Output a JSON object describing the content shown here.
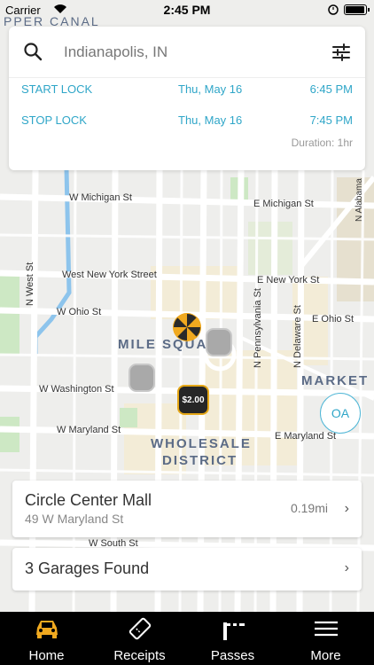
{
  "status_bar": {
    "carrier": "Carrier",
    "time": "2:45 PM"
  },
  "search": {
    "location": "Indianapolis, IN"
  },
  "lock": {
    "start": {
      "label": "START LOCK",
      "date": "Thu, May 16",
      "time": "6:45 PM"
    },
    "stop": {
      "label": "STOP LOCK",
      "date": "Thu, May 16",
      "time": "7:45 PM"
    },
    "duration": "Duration: 1hr"
  },
  "map": {
    "streets": {
      "w_michigan": "W Michigan St",
      "e_michigan": "E Michigan St",
      "west_new_york": "West New York Street",
      "e_new_york": "E New York St",
      "w_ohio": "W Ohio St",
      "e_ohio": "E Ohio St",
      "w_washington": "W Washington St",
      "w_maryland": "W Maryland St",
      "e_maryland": "E Maryland St",
      "w_south": "W South St",
      "n_west": "N West St",
      "n_pennsylvania": "N Pennsylvania St",
      "n_delaware": "N Delaware St",
      "n_alabama": "N Alabama",
      "canal": "PPER CANAL"
    },
    "districts": {
      "mile_square": "MILE SQUARE",
      "wholesale": "WHOLESALE",
      "district": "DISTRICT",
      "market": "MARKET"
    },
    "price_marker": "$2.00",
    "oa_button": "OA"
  },
  "result": {
    "name": "Circle Center Mall",
    "address": "49 W Maryland St",
    "distance": "0.19mi"
  },
  "garages": {
    "label": "3 Garages Found"
  },
  "tabs": [
    {
      "label": "Home",
      "icon": "car-icon",
      "color": "#f0a91f"
    },
    {
      "label": "Receipts",
      "icon": "ticket-icon"
    },
    {
      "label": "Passes",
      "icon": "gate-icon"
    },
    {
      "label": "More",
      "icon": "menu-icon"
    }
  ],
  "colors": {
    "accent": "#2fa6c8",
    "brand": "#f0a91f",
    "tabbar": "#000000"
  }
}
